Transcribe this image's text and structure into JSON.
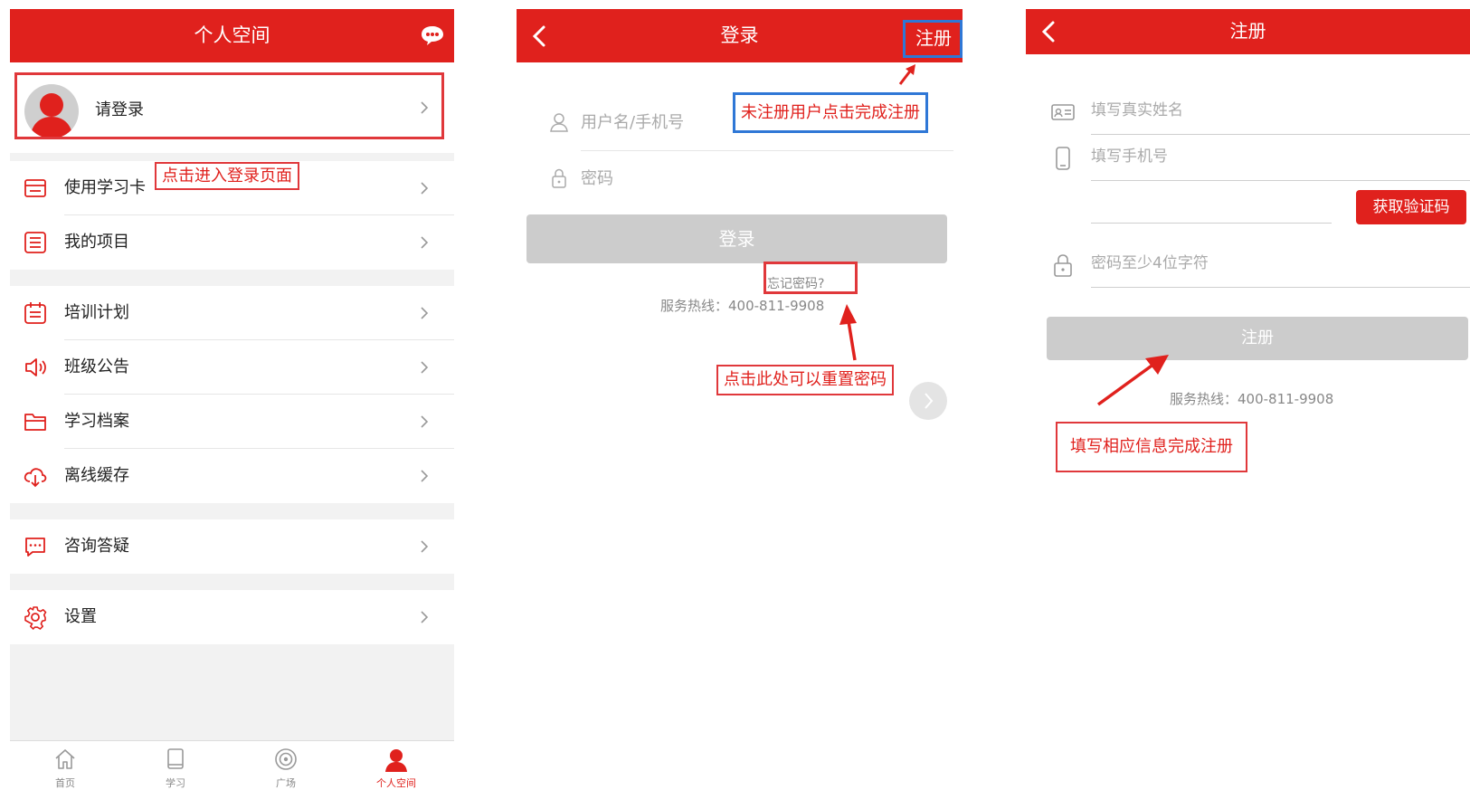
{
  "colors": {
    "brand_red": "#e0211d",
    "annotation_red": "#e0383b",
    "annotation_blue": "#2f77d6",
    "disabled_grey": "#cccccc"
  },
  "screen1": {
    "title": "个人空间",
    "header_icon": "chat-bubble-icon",
    "profile_label": "请登录",
    "menu": [
      {
        "label": "使用学习卡",
        "icon": "card-icon"
      },
      {
        "label": "我的项目",
        "icon": "list-icon"
      },
      {
        "label": "培训计划",
        "icon": "calendar-icon"
      },
      {
        "label": "班级公告",
        "icon": "speaker-icon"
      },
      {
        "label": "学习档案",
        "icon": "folder-icon"
      },
      {
        "label": "离线缓存",
        "icon": "cloud-download-icon"
      },
      {
        "label": "咨询答疑",
        "icon": "message-icon"
      },
      {
        "label": "设置",
        "icon": "gear-icon"
      }
    ],
    "tabs": [
      {
        "label": "首页",
        "icon": "home-icon"
      },
      {
        "label": "学习",
        "icon": "book-icon"
      },
      {
        "label": "广场",
        "icon": "target-icon"
      },
      {
        "label": "个人空间",
        "icon": "person-icon",
        "active": true
      }
    ],
    "annotation": "点击进入登录页面"
  },
  "screen2": {
    "title": "登录",
    "register_link": "注册",
    "username_placeholder": "用户名/手机号",
    "password_placeholder": "密码",
    "login_button": "登录",
    "forgot_password": "忘记密码?",
    "hotline": "服务热线：400-811-9908",
    "annotation_register": "未注册用户点击完成注册",
    "annotation_reset": "点击此处可以重置密码"
  },
  "screen3": {
    "title": "注册",
    "name_placeholder": "填写真实姓名",
    "phone_placeholder": "填写手机号",
    "get_code_button": "获取验证码",
    "password_placeholder": "密码至少4位字符",
    "register_button": "注册",
    "hotline": "服务热线：400-811-9908",
    "annotation": "填写相应信息完成注册"
  }
}
